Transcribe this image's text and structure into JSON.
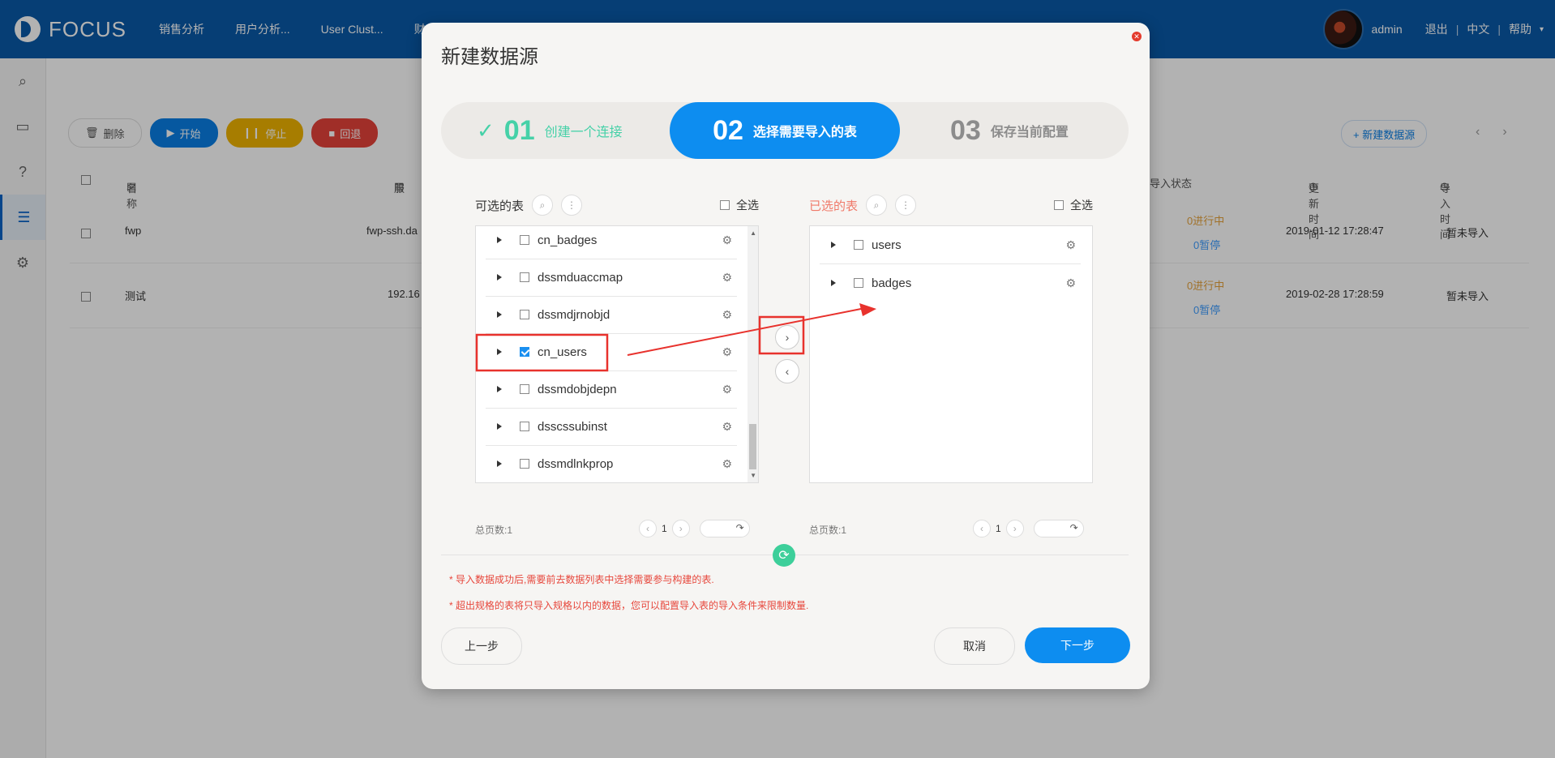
{
  "app": {
    "logo": "FOCUS"
  },
  "nav": [
    "销售分析",
    "用户分析...",
    "User Clust...",
    "财务"
  ],
  "user": {
    "name": "admin",
    "logout": "退出",
    "lang": "中文",
    "help": "帮助",
    "sep": "|"
  },
  "sidebar": {
    "icons": [
      "search-icon",
      "dashboard-icon",
      "help-icon",
      "datasource-icon",
      "settings-icon"
    ]
  },
  "background": {
    "toolbar": {
      "delete": "删除",
      "start": "开始",
      "stop": "停止",
      "rollback": "回退"
    },
    "new_datasource": "+ 新建数据源",
    "columns": {
      "name": "名称",
      "server": "服",
      "import_status": "导入状态",
      "update_time": "更新时间",
      "import_time": "导入时间"
    },
    "rows": [
      {
        "name": "fwp",
        "server": "fwp-ssh.da",
        "running": "0进行中",
        "paused": "0暂停",
        "updated": "2019-01-12 17:28:47",
        "imported": "暂未导入"
      },
      {
        "name": "测试",
        "server": "192.16",
        "running": "0进行中",
        "paused": "0暂停",
        "updated": "2019-02-28 17:28:59",
        "imported": "暂未导入"
      }
    ]
  },
  "modal": {
    "title": "新建数据源",
    "steps": [
      {
        "num": "01",
        "label": "创建一个连接"
      },
      {
        "num": "02",
        "label": "选择需要导入的表"
      },
      {
        "num": "03",
        "label": "保存当前配置"
      }
    ],
    "left": {
      "title": "可选的表",
      "select_all": "全选",
      "items": [
        {
          "name": "cn_badges",
          "checked": false
        },
        {
          "name": "dssmduaccmap",
          "checked": false
        },
        {
          "name": "dssmdjrnobjd",
          "checked": false
        },
        {
          "name": "cn_users",
          "checked": true
        },
        {
          "name": "dssmdobjdepn",
          "checked": false
        },
        {
          "name": "dsscssubinst",
          "checked": false
        },
        {
          "name": "dssmdlnkprop",
          "checked": false
        }
      ],
      "total_pages": "总页数:1",
      "page": "1"
    },
    "right": {
      "title": "已选的表",
      "select_all": "全选",
      "items": [
        {
          "name": "users",
          "checked": false
        },
        {
          "name": "badges",
          "checked": false
        }
      ],
      "total_pages": "总页数:1",
      "page": "1"
    },
    "notes": [
      "* 导入数据成功后,需要前去数据列表中选择需要参与构建的表.",
      "* 超出规格的表将只导入规格以内的数据，您可以配置导入表的导入条件来限制数量."
    ],
    "buttons": {
      "prev": "上一步",
      "cancel": "取消",
      "next": "下一步"
    }
  },
  "colors": {
    "primary": "#0d8df0",
    "topbar": "#0a5aa8",
    "success": "#46d1a8",
    "annotation": "#e8322d"
  }
}
